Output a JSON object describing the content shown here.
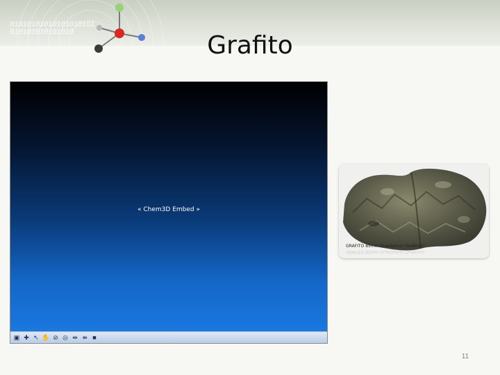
{
  "slide": {
    "title": "Grafito",
    "number": "11"
  },
  "header": {
    "binary_line_1": "01010101010101010101",
    "binary_line_2": "010101010101010"
  },
  "chem3d": {
    "placeholder": "« Chem3D Embed »",
    "view_gradient": [
      "#000000",
      "#0a3a78",
      "#1a78e0"
    ],
    "toolbar": [
      {
        "icon": "select-icon",
        "glyph": "▣"
      },
      {
        "icon": "rotate-icon",
        "glyph": "✚"
      },
      {
        "icon": "pointer-icon",
        "glyph": "↖"
      },
      {
        "icon": "hand-icon",
        "glyph": "✋"
      },
      {
        "icon": "zoom-icon",
        "glyph": "⊘"
      },
      {
        "icon": "magnify-icon",
        "glyph": "◎"
      },
      {
        "icon": "bond-icon",
        "glyph": "⇹"
      },
      {
        "icon": "atom-icon",
        "glyph": "⇻"
      },
      {
        "icon": "stop-icon",
        "glyph": "■"
      }
    ]
  },
  "photo": {
    "caption": "GRAFITO 85mm Gualdamar (Sulkhov)"
  }
}
